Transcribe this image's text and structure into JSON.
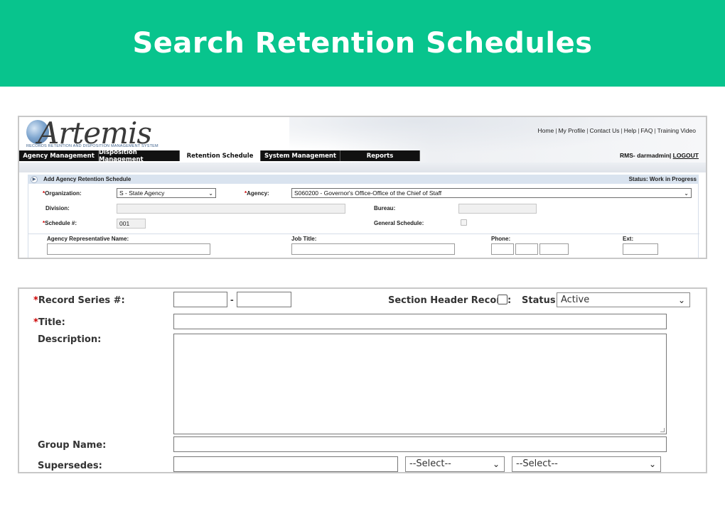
{
  "banner": {
    "title": "Search Retention Schedules"
  },
  "header": {
    "logo_text": "Artemis",
    "logo_tagline": "RECORDS RETENTION AND DISPOSITION MANAGEMENT SYSTEM",
    "top_links": [
      "Home",
      "My Profile",
      "Contact Us",
      "Help",
      "FAQ",
      "Training Video"
    ],
    "nav_tabs": [
      "Agency Management",
      "Disposition Management",
      "Retention Schedule",
      "System Management",
      "Reports"
    ],
    "active_tab": "Retention Schedule",
    "user_label": "RMS- darmadmin|",
    "logout_label": "LOGOUT"
  },
  "section": {
    "title": "Add Agency Retention Schedule",
    "status": "Status: Work in Progress"
  },
  "form1": {
    "organization_label": "Organization:",
    "organization_value": "S - State Agency",
    "agency_label": "Agency:",
    "agency_value": "S060200 - Governor's Office-Office of the Chief of Staff",
    "division_label": "Division:",
    "division_value": "",
    "bureau_label": "Bureau:",
    "bureau_value": "",
    "schedule_label": "Schedule #:",
    "schedule_value": "001",
    "general_schedule_label": "General Schedule:",
    "rep_name_label": "Agency Representative Name:",
    "job_title_label": "Job Title:",
    "phone_label": "Phone:",
    "ext_label": "Ext:",
    "required_mark": "*"
  },
  "form2": {
    "record_series_label": "Record Series #:",
    "dash": "-",
    "section_header_label": "Section Header Record:",
    "status_label": "Status:",
    "status_value": "Active",
    "title_label": "Title:",
    "description_label": "Description:",
    "group_name_label": "Group Name:",
    "supersedes_label": "Supersedes:",
    "select_placeholder_1": "--Select--",
    "select_placeholder_2": "--Select--",
    "required_mark": "*"
  },
  "colors": {
    "banner": "#08c48d",
    "nav": "#111111",
    "section_head": "#d9e3ef",
    "required": "#cc0000"
  },
  "icons": {
    "expand": "triangle-right-icon",
    "dropdown": "chevron-down-icon"
  }
}
